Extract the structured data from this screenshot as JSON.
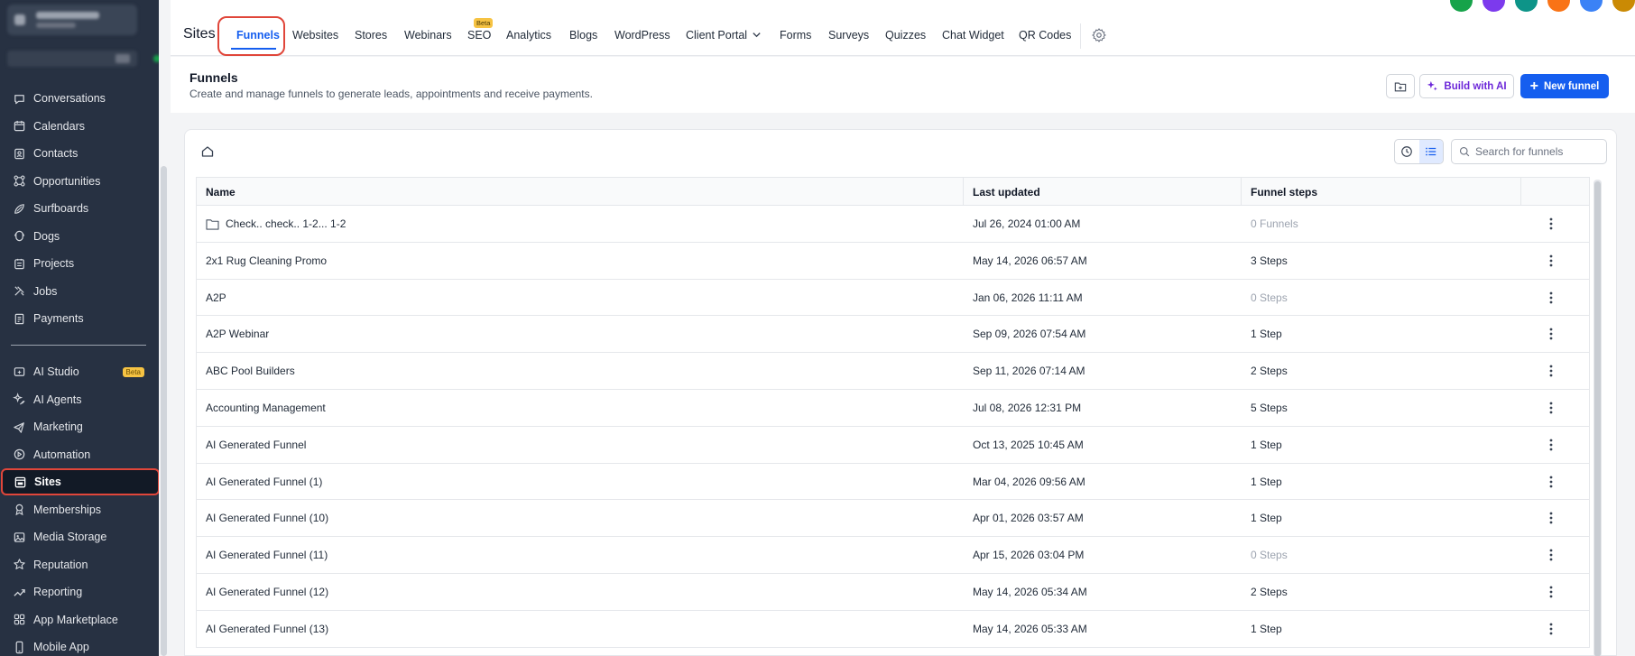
{
  "sidebar": {
    "nav_group_1": [
      {
        "label": "Conversations",
        "icon": "chat-icon"
      },
      {
        "label": "Calendars",
        "icon": "calendar-icon"
      },
      {
        "label": "Contacts",
        "icon": "contacts-icon"
      },
      {
        "label": "Opportunities",
        "icon": "opportunities-icon"
      },
      {
        "label": "Surfboards",
        "icon": "surfboard-icon"
      },
      {
        "label": "Dogs",
        "icon": "dog-icon"
      },
      {
        "label": "Projects",
        "icon": "projects-icon"
      },
      {
        "label": "Jobs",
        "icon": "jobs-icon"
      },
      {
        "label": "Payments",
        "icon": "payments-icon"
      }
    ],
    "nav_group_2": [
      {
        "label": "AI Studio",
        "icon": "ai-studio-icon",
        "badge": "Beta"
      },
      {
        "label": "AI Agents",
        "icon": "ai-agents-icon"
      },
      {
        "label": "Marketing",
        "icon": "marketing-icon"
      },
      {
        "label": "Automation",
        "icon": "automation-icon"
      },
      {
        "label": "Sites",
        "icon": "sites-icon",
        "active": true
      },
      {
        "label": "Memberships",
        "icon": "memberships-icon"
      },
      {
        "label": "Media Storage",
        "icon": "media-storage-icon"
      },
      {
        "label": "Reputation",
        "icon": "star-icon"
      },
      {
        "label": "Reporting",
        "icon": "reporting-icon"
      },
      {
        "label": "App Marketplace",
        "icon": "app-marketplace-icon"
      },
      {
        "label": "Mobile App",
        "icon": "mobile-icon"
      }
    ]
  },
  "topnav": {
    "title": "Sites",
    "tabs": [
      "Funnels",
      "Websites",
      "Stores",
      "Webinars",
      "SEO",
      "Analytics",
      "Blogs",
      "WordPress",
      "Client Portal",
      "Forms",
      "Surveys",
      "Quizzes",
      "Chat Widget",
      "QR Codes"
    ],
    "active_tab": "Funnels",
    "seo_badge": "Beta"
  },
  "page": {
    "title": "Funnels",
    "subtitle": "Create and manage funnels to generate leads, appointments and receive payments.",
    "build_ai_label": "Build with AI",
    "new_funnel_label": "New funnel"
  },
  "search": {
    "placeholder": "Search for funnels"
  },
  "table": {
    "columns": [
      "Name",
      "Last updated",
      "Funnel steps"
    ],
    "rows": [
      {
        "name": "Check.. check.. 1-2... 1-2",
        "updated": "Jul 26, 2024 01:00 AM",
        "steps": "0 Funnels",
        "folder": true,
        "muted": true
      },
      {
        "name": "2x1 Rug Cleaning Promo",
        "updated": "May 14, 2026 06:57 AM",
        "steps": "3 Steps",
        "muted": false
      },
      {
        "name": "A2P",
        "updated": "Jan 06, 2026 11:11 AM",
        "steps": "0 Steps",
        "muted": true
      },
      {
        "name": "A2P Webinar",
        "updated": "Sep 09, 2026 07:54 AM",
        "steps": "1 Step",
        "muted": false
      },
      {
        "name": "ABC Pool Builders",
        "updated": "Sep 11, 2026 07:14 AM",
        "steps": "2 Steps",
        "muted": false
      },
      {
        "name": "Accounting Management",
        "updated": "Jul 08, 2026 12:31 PM",
        "steps": "5 Steps",
        "muted": false
      },
      {
        "name": "AI Generated Funnel",
        "updated": "Oct 13, 2025 10:45 AM",
        "steps": "1 Step",
        "muted": false
      },
      {
        "name": "AI Generated Funnel (1)",
        "updated": "Mar 04, 2026 09:56 AM",
        "steps": "1 Step",
        "muted": false
      },
      {
        "name": "AI Generated Funnel (10)",
        "updated": "Apr 01, 2026 03:57 AM",
        "steps": "1 Step",
        "muted": false
      },
      {
        "name": "AI Generated Funnel (11)",
        "updated": "Apr 15, 2026 03:04 PM",
        "steps": "0 Steps",
        "muted": true
      },
      {
        "name": "AI Generated Funnel (12)",
        "updated": "May 14, 2026 05:34 AM",
        "steps": "2 Steps",
        "muted": false
      },
      {
        "name": "AI Generated Funnel (13)",
        "updated": "May 14, 2026 05:33 AM",
        "steps": "1 Step",
        "muted": false
      }
    ]
  },
  "colors": {
    "accent": "#155eef",
    "highlight": "#e0463a",
    "sidebar_bg": "#273142",
    "ai_purple": "#6d28d9",
    "beta_badge": "#f6c343"
  },
  "avatars": [
    "#16a34a",
    "#7c3aed",
    "#0d9488",
    "#f97316",
    "#3b82f6",
    "#ca8a04"
  ]
}
